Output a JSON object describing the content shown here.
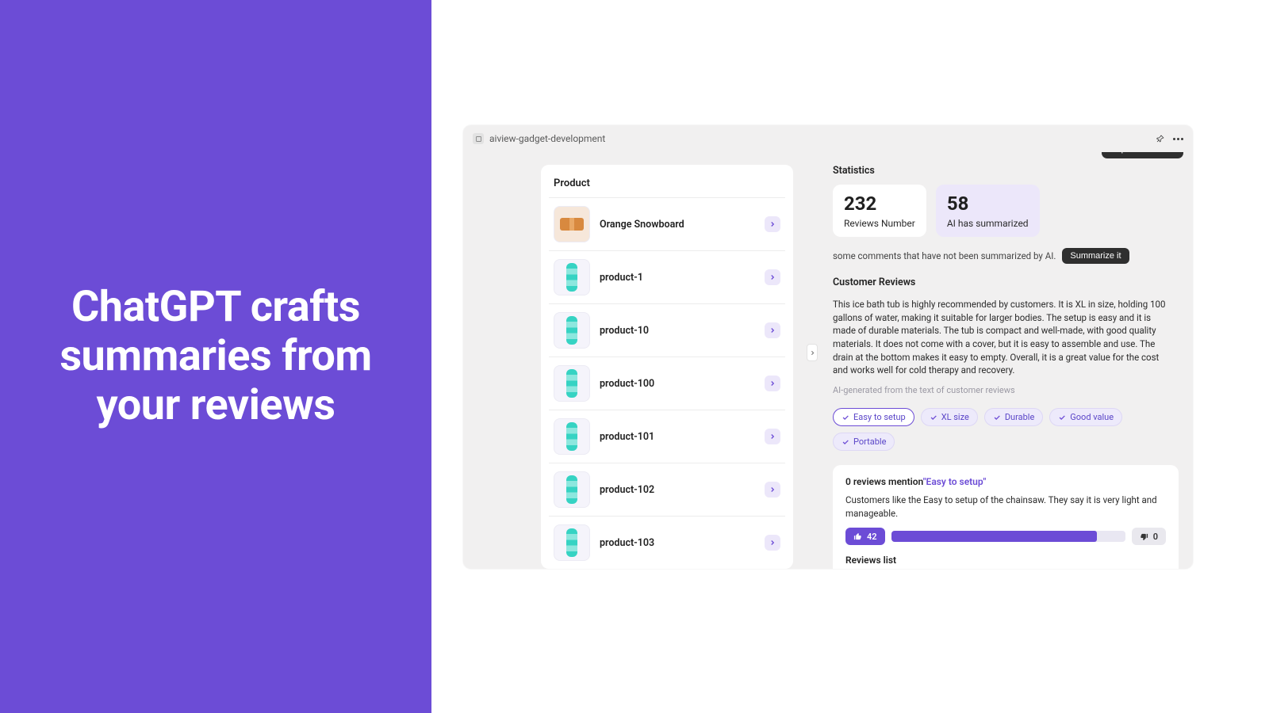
{
  "hero": {
    "headline": "ChatGPT crafts summaries from your reviews"
  },
  "app": {
    "name": "aiview-gadget-development",
    "import_label": "Import Reviews"
  },
  "products": {
    "title": "Product",
    "items": [
      {
        "label": "Orange Snowboard",
        "variant": "orange"
      },
      {
        "label": "product-1",
        "variant": "board"
      },
      {
        "label": "product-10",
        "variant": "board"
      },
      {
        "label": "product-100",
        "variant": "board"
      },
      {
        "label": "product-101",
        "variant": "board"
      },
      {
        "label": "product-102",
        "variant": "board"
      },
      {
        "label": "product-103",
        "variant": "board"
      }
    ]
  },
  "stats": {
    "title": "Statistics",
    "reviews_number": "232",
    "reviews_number_label": "Reviews Number",
    "ai_summarized": "58",
    "ai_summarized_label": "AI has summarized"
  },
  "summarize": {
    "note": "some comments that have not been summarized by AI.",
    "button": "Summarize it"
  },
  "customer_reviews": {
    "title": "Customer Reviews",
    "body": "This ice bath tub is highly recommended by customers. It is XL in size, holding 100 gallons of water, making it suitable for larger bodies. The setup is easy and it is made of durable materials. The tub is compact and well-made, with good quality materials. It does not come with a cover, but it is easy to assemble and use. The drain at the bottom makes it easy to empty. Overall, it is a great value for the cost and works well for cold therapy and recovery.",
    "ai_note": "AI-generated from the text of customer reviews"
  },
  "chips": [
    {
      "label": "Easy to setup",
      "active": true
    },
    {
      "label": "XL size",
      "active": false
    },
    {
      "label": "Durable",
      "active": false
    },
    {
      "label": "Good value",
      "active": false
    },
    {
      "label": "Portable",
      "active": false
    }
  ],
  "mention": {
    "count_text": "0 reviews mention",
    "tag": "\"Easy to setup\"",
    "body": "Customers like the Easy to setup of the chainsaw. They say it is very light and manageable.",
    "up_count": "42",
    "down_count": "0",
    "bar_percent": 88,
    "list_label": "Reviews list"
  }
}
